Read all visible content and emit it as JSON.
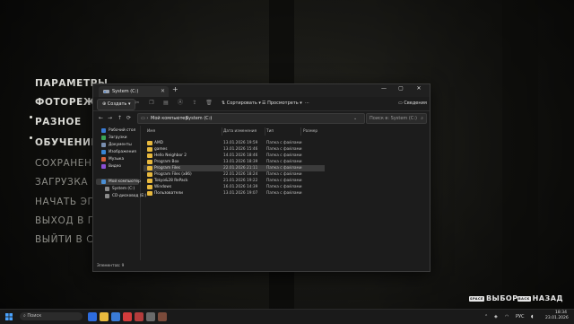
{
  "game_menu": {
    "items": [
      {
        "label": "ПАРАМЕТРЫ",
        "active": true,
        "dot": false
      },
      {
        "label": "ФОТОРЕЖИМ",
        "active": true,
        "dot": false
      },
      {
        "label": "РАЗНОЕ",
        "active": true,
        "dot": true
      },
      {
        "label": "ОБУЧЕНИЕ",
        "active": true,
        "dot": true
      },
      {
        "label": "СОХРАНЕНИЕ",
        "active": false,
        "dot": false
      },
      {
        "label": "ЗАГРУЗКА ИГРЫ",
        "active": false,
        "dot": false
      },
      {
        "label": "НАЧАТЬ ЭПИЗОД",
        "active": false,
        "dot": false
      },
      {
        "label": "ВЫХОД В ГЛАВНОЕ МЕНЮ",
        "active": false,
        "dot": false
      },
      {
        "label": "ВЫЙТИ В СИСТЕМУ",
        "active": false,
        "dot": false
      }
    ],
    "prompt_select": {
      "key": "SPACE",
      "label": "ВЫБОР"
    },
    "prompt_back": {
      "key": "BACK",
      "label": "НАЗАД"
    }
  },
  "explorer": {
    "tab_title": "System (C:)",
    "create_label": "Создать",
    "sort_label": "Сортировать",
    "view_label": "Просмотреть",
    "details_label": "Сведения",
    "breadcrumb": [
      "Мой компьютер",
      "System (C:)"
    ],
    "search_placeholder": "Поиск в: System (C:)",
    "sidebar": [
      {
        "label": "Рабочий стол",
        "color": "#3a7bd5"
      },
      {
        "label": "Загрузки",
        "color": "#3aa655"
      },
      {
        "label": "Документы",
        "color": "#7a8fb0"
      },
      {
        "label": "Изображения",
        "color": "#3a86d5"
      },
      {
        "label": "Музыка",
        "color": "#d5603a"
      },
      {
        "label": "Видео",
        "color": "#8a4fd5"
      },
      {
        "label": "Мой компьютер",
        "color": "#4a8fd5"
      },
      {
        "label": "System (C:)",
        "color": "#8a8a8a"
      },
      {
        "label": "CD-дисковод (E:)",
        "color": "#8a8a8a"
      }
    ],
    "columns": [
      "Имя",
      "Дата изменения",
      "Тип",
      "Размер"
    ],
    "files": [
      {
        "name": "AMD",
        "date": "13.01.2026 19:59",
        "type": "Папка с файлами"
      },
      {
        "name": "games",
        "date": "13.01.2026 15:46",
        "type": "Папка с файлами"
      },
      {
        "name": "Hello Neighbor 2",
        "date": "14.01.2026 18:46",
        "type": "Папка с файлами"
      },
      {
        "name": "Program Box",
        "date": "13.01.2026 18:39",
        "type": "Папка с файлами"
      },
      {
        "name": "Program Files",
        "date": "22.01.2026 21:11",
        "type": "Папка с файлами"
      },
      {
        "name": "Program Files (x86)",
        "date": "22.01.2026 18:24",
        "type": "Папка с файлами"
      },
      {
        "name": "Tokyo&28 RePack",
        "date": "21.01.2026 19:22",
        "type": "Папка с файлами"
      },
      {
        "name": "Windows",
        "date": "16.01.2026 14:39",
        "type": "Папка с файлами"
      },
      {
        "name": "Пользователи",
        "date": "13.01.2026 19:07",
        "type": "Папка с файлами"
      }
    ],
    "highlighted_index": 4,
    "status": "Элементов: 9"
  },
  "taskbar": {
    "search_label": "Поиск",
    "language": "РУС",
    "time": "18:34",
    "date": "23.01.2026",
    "app_colors": [
      "#2d6cdf",
      "#e8b93e",
      "#3a7bd5",
      "#d23c3c",
      "#b33c3c",
      "#6a6a6a",
      "#7a4a3a"
    ]
  }
}
